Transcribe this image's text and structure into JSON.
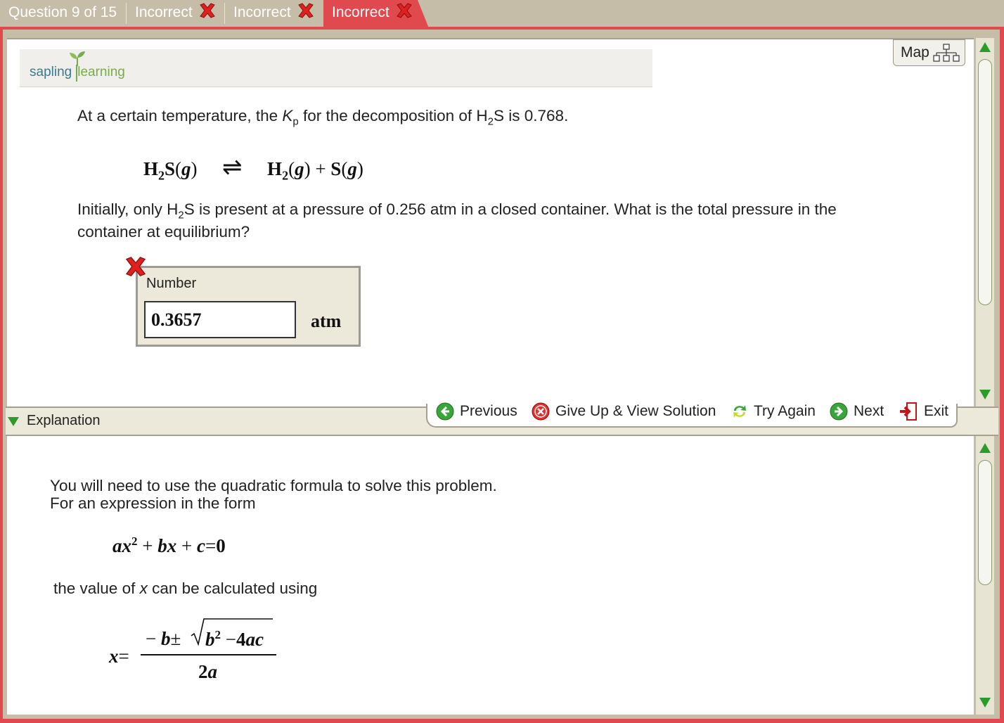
{
  "tabs": {
    "question_counter": "Question 9 of 15",
    "attempts": [
      {
        "label": "Incorrect"
      },
      {
        "label": "Incorrect"
      },
      {
        "label": "Incorrect"
      }
    ]
  },
  "header": {
    "logo_part1": "sapling",
    "logo_part2": "learning",
    "map_label": "Map"
  },
  "question": {
    "line1_a": "At a certain temperature, the ",
    "line1_k": "K",
    "line1_ksub": "p",
    "line1_b": " for the decomposition of H",
    "line1_sub": "2",
    "line1_c": "S is 0.768.",
    "equation": {
      "reactant": "H",
      "reactant_sub": "2",
      "reactant_rest": "S",
      "reactant_state": "g",
      "arrow": "⇌",
      "product1": "H",
      "product1_sub": "2",
      "product1_state": "g",
      "plus": "+",
      "product2": "S",
      "product2_state": "g"
    },
    "line2_a": "Initially, only H",
    "line2_sub": "2",
    "line2_b": "S is present at a pressure of 0.256 atm in a closed container. What is the total pressure in the",
    "line3": "container at equilibrium?"
  },
  "answer": {
    "label": "Number",
    "value": "0.3657",
    "unit": "atm",
    "status": "incorrect"
  },
  "nav": {
    "explanation_label": "Explanation",
    "previous": "Previous",
    "give_up": "Give Up & View Solution",
    "try_again": "Try Again",
    "next": "Next",
    "exit": "Exit"
  },
  "explanation": {
    "p1": "You will need to use the quadratic formula to solve this problem.",
    "p2": "For an expression in the form",
    "p3_a": "the value of ",
    "p3_x": "x",
    "p3_b": " can be calculated using",
    "formula1": {
      "a": "a",
      "x": "x",
      "exp": "2",
      "plus1": "+",
      "b": "b",
      "x2": "x",
      "plus2": "+",
      "c": "c",
      "eq": "=",
      "zero": "0"
    },
    "formula2": {
      "x": "x",
      "eq": "=",
      "neg": "−",
      "b": "b",
      "pm": "±",
      "b2": "b",
      "exp": "2",
      "minus": "−",
      "four": "4",
      "ac": "ac",
      "two": "2",
      "a": "a"
    }
  },
  "colors": {
    "frame_red": "#e04a4f",
    "beige": "#c6bda9",
    "panel_beige": "#ece8da",
    "scroll_green": "#2d9a2d"
  }
}
